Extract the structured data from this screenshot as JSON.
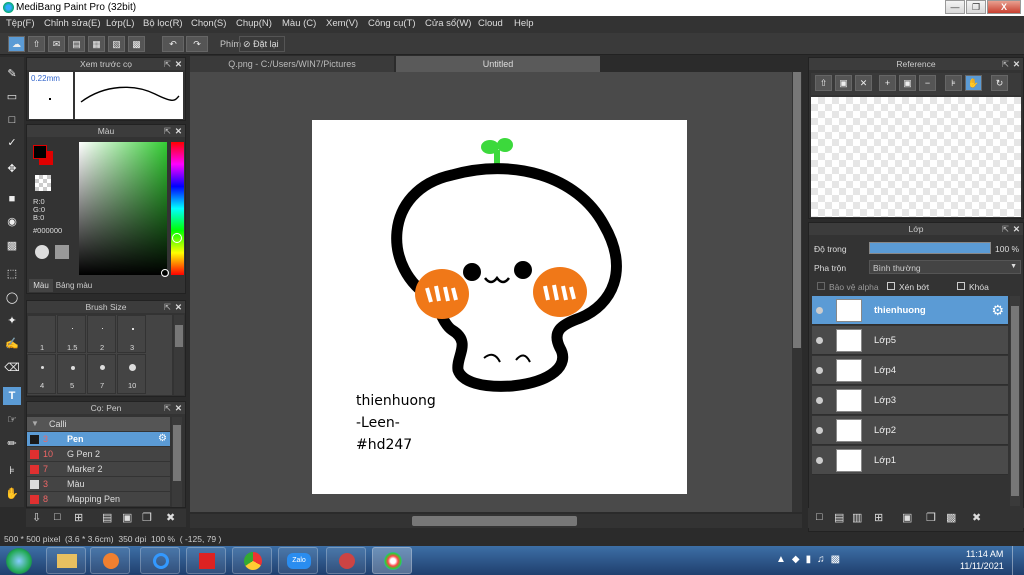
{
  "window": {
    "title": "MediBang Paint Pro (32bit)"
  },
  "menu": [
    "Tệp(F)",
    "Chỉnh sửa(E)",
    "Lớp(L)",
    "Bộ lọc(R)",
    "Chọn(S)",
    "Chụp(N)",
    "Màu (C)",
    "Xem(V)",
    "Công cụ(T)",
    "Cửa sổ(W)",
    "Cloud",
    "Help"
  ],
  "toolbar": {
    "phim_label": "Phím",
    "reset_label": "Đặt lại"
  },
  "brush_preview": {
    "title": "Xem trước cọ",
    "size": "0.22mm"
  },
  "color_panel": {
    "title": "Màu",
    "r": "R:0",
    "g": "G:0",
    "b": "B:0",
    "hex": "#000000",
    "tab_color": "Màu",
    "tab_palette": "Bảng màu"
  },
  "brush_size": {
    "title": "Brush Size",
    "sizes": [
      "1",
      "1.5",
      "2",
      "3",
      "4",
      "5",
      "7",
      "10"
    ]
  },
  "brush_panel": {
    "title": "Cọ: Pen",
    "group": "Calli",
    "items": [
      {
        "size": "3",
        "name": "Pen",
        "color": "#1a1a1a"
      },
      {
        "size": "10",
        "name": "G Pen 2",
        "color": "#e03030"
      },
      {
        "size": "7",
        "name": "Marker 2",
        "color": "#e03030"
      },
      {
        "size": "3",
        "name": "Màu",
        "color": "#dddddd"
      },
      {
        "size": "8",
        "name": "Mapping Pen",
        "color": "#e03030"
      }
    ]
  },
  "tabs": {
    "file1": "Q.png - C:/Users/WIN7/Pictures",
    "file2": "Untitled"
  },
  "canvas": {
    "text_lines": [
      "thienhuong",
      "-Leen-",
      "#hd247"
    ]
  },
  "reference": {
    "title": "Reference"
  },
  "layer_panel": {
    "title": "Lớp",
    "opacity_label": "Độ trong",
    "opacity_value": "100 %",
    "blend_label": "Pha trộn",
    "blend_value": "Bình thường",
    "protect_alpha": "Bảo vệ alpha",
    "clipping": "Xén bớt",
    "lock": "Khóa",
    "layers": [
      {
        "name": "thienhuong"
      },
      {
        "name": "Lớp5"
      },
      {
        "name": "Lớp4"
      },
      {
        "name": "Lớp3"
      },
      {
        "name": "Lớp2"
      },
      {
        "name": "Lớp1"
      }
    ]
  },
  "status": {
    "text": "500 * 500 pixel  (3.6 * 3.6cm)  350 dpi  100 %  ( -125, 79 )"
  },
  "taskbar": {
    "time": "11:14 AM",
    "date": "11/11/2021",
    "zalo": "Zalo"
  },
  "colors": {
    "accent": "#5b9bd5",
    "primary_color": "#000000",
    "secondary_color": "#e00000"
  }
}
